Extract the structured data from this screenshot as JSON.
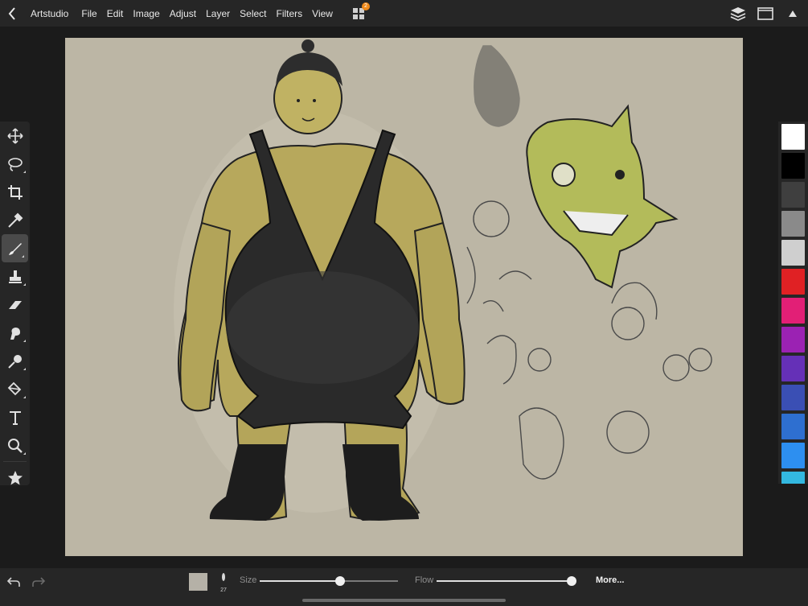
{
  "app": {
    "name": "Artstudio",
    "menu": [
      "File",
      "Edit",
      "Image",
      "Adjust",
      "Layer",
      "Select",
      "Filters",
      "View"
    ],
    "extensions_badge": "2"
  },
  "icons": {
    "back": "chevron-left-icon",
    "extensions": "grid-icon",
    "layers": "layers-stack-icon",
    "fullscreen": "window-icon",
    "collapse": "triangle-up-icon"
  },
  "tools": [
    {
      "name": "move-tool",
      "icon": "move-arrows-icon"
    },
    {
      "name": "lasso-tool",
      "icon": "lasso-icon",
      "has_submenu": true
    },
    {
      "name": "crop-tool",
      "icon": "crop-icon"
    },
    {
      "name": "eyedropper-tool",
      "icon": "eyedropper-icon"
    },
    {
      "name": "brush-tool",
      "icon": "brush-icon",
      "has_submenu": true,
      "active": true
    },
    {
      "name": "stamp-tool",
      "icon": "stamp-icon",
      "has_submenu": true
    },
    {
      "name": "eraser-tool",
      "icon": "eraser-icon"
    },
    {
      "name": "smudge-tool",
      "icon": "smudge-icon",
      "has_submenu": true
    },
    {
      "name": "dodge-tool",
      "icon": "dodge-icon",
      "has_submenu": true
    },
    {
      "name": "fill-tool",
      "icon": "paint-bucket-icon",
      "has_submenu": true
    },
    {
      "name": "text-tool",
      "icon": "text-icon"
    },
    {
      "name": "zoom-tool",
      "icon": "magnifier-icon",
      "has_submenu": true
    },
    {
      "name": "favorites-tool",
      "icon": "star-icon"
    }
  ],
  "palette": [
    "#ffffff",
    "#000000",
    "#3f3f3f",
    "#8a8a8a",
    "#cfcfcf",
    "#e02124",
    "#e21f76",
    "#9b22b3",
    "#6530b7",
    "#3a4fb4",
    "#2e6fd0",
    "#2d8ff0",
    "#33b8e0"
  ],
  "bottom": {
    "color_sample": "#b5b1a7",
    "brush_size": "27",
    "size_label": "Size",
    "size_value": 0.58,
    "flow_label": "Flow",
    "flow_value": 1.0,
    "more_label": "More..."
  }
}
